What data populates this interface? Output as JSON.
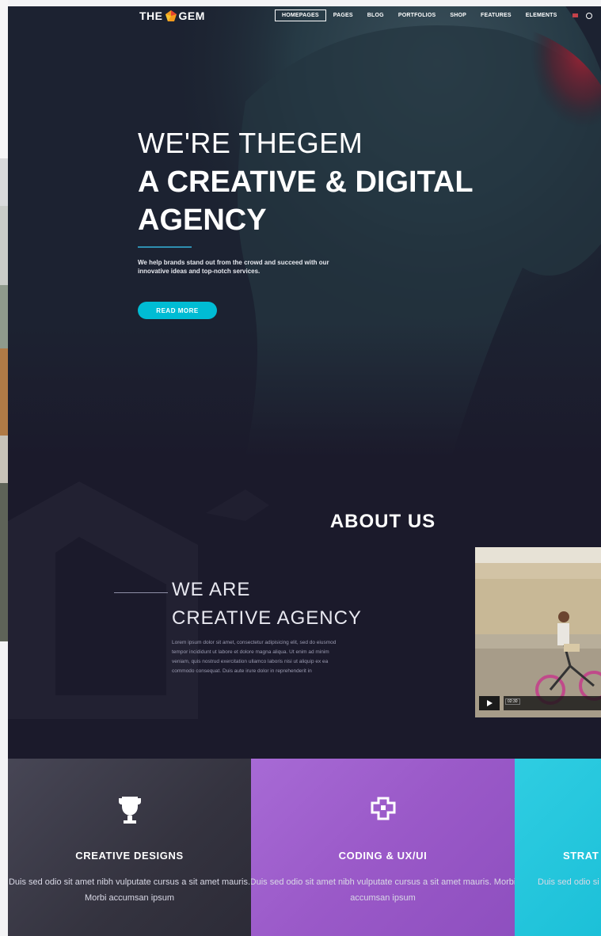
{
  "brand": {
    "logo_left": "THE",
    "logo_right": "GEM"
  },
  "nav": {
    "items": [
      "HOMEPAGES",
      "PAGES",
      "BLOG",
      "PORTFOLIOS",
      "SHOP",
      "FEATURES",
      "ELEMENTS"
    ]
  },
  "hero": {
    "pretitle": "WE'RE THEGEM",
    "title": "A CREATIVE & DIGITAL\nAGENCY",
    "text": "We help brands stand out from the crowd and succeed with our innovative ideas and top-notch services.",
    "cta_label": "READ MORE"
  },
  "about": {
    "title": "ABOUT US",
    "heading": "WE ARE\nCREATIVE AGENCY",
    "text": "Lorem ipsum dolor sit amet, consectetur adipisicing elit, sed do eiusmod tempor incididunt ut labore et dolore magna aliqua. Ut enim ad minim veniam, quis nostrud exercitation ullamco laboris nisi ut aliquip ex ea commodo consequat. Duis aute irure dolor in reprehenderit in",
    "video_time": "02:30"
  },
  "features": [
    {
      "title": "CREATIVE DESIGNS",
      "text": "Duis sed odio sit amet nibh vulputate cursus a sit amet mauris. Morbi accumsan ipsum",
      "icon": "trophy-icon"
    },
    {
      "title": "CODING & UX/UI",
      "text": "Duis sed odio sit amet nibh vulputate cursus a sit amet mauris. Morbi accumsan ipsum",
      "icon": "puzzle-icon"
    },
    {
      "title": "STRAT",
      "text": "Duis sed odio si mau",
      "icon": ""
    }
  ],
  "colors": {
    "accent": "#00bcd4",
    "background": "#1b1a2b",
    "feature_dark": "#3a3a48",
    "feature_purple": "#9c59c9",
    "feature_cyan": "#1fc3da"
  }
}
